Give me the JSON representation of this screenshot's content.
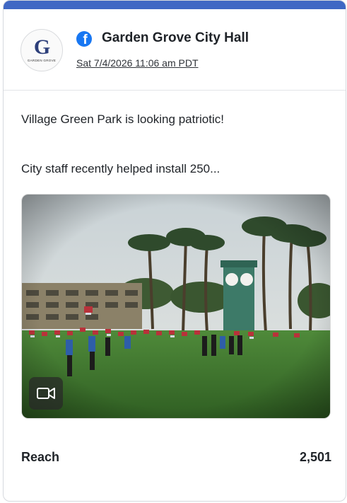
{
  "post": {
    "page_name": "Garden Grove City Hall",
    "timestamp": "Sat 7/4/2026 11:06 am PDT",
    "platform_icon": "facebook-icon",
    "logo": {
      "letter": "G",
      "caption": "GARDEN GROVE"
    },
    "text_line1": "Village Green Park is looking patriotic!",
    "text_line2": "City staff recently helped install 250...",
    "media_type": "video",
    "media_badge_icon": "video-camera-icon"
  },
  "metrics": {
    "reach_label": "Reach",
    "reach_value": "2,501"
  },
  "colors": {
    "accent_bar": "#3f67c4",
    "facebook_blue": "#1877f2",
    "logo_navy": "#2d3f7a"
  }
}
